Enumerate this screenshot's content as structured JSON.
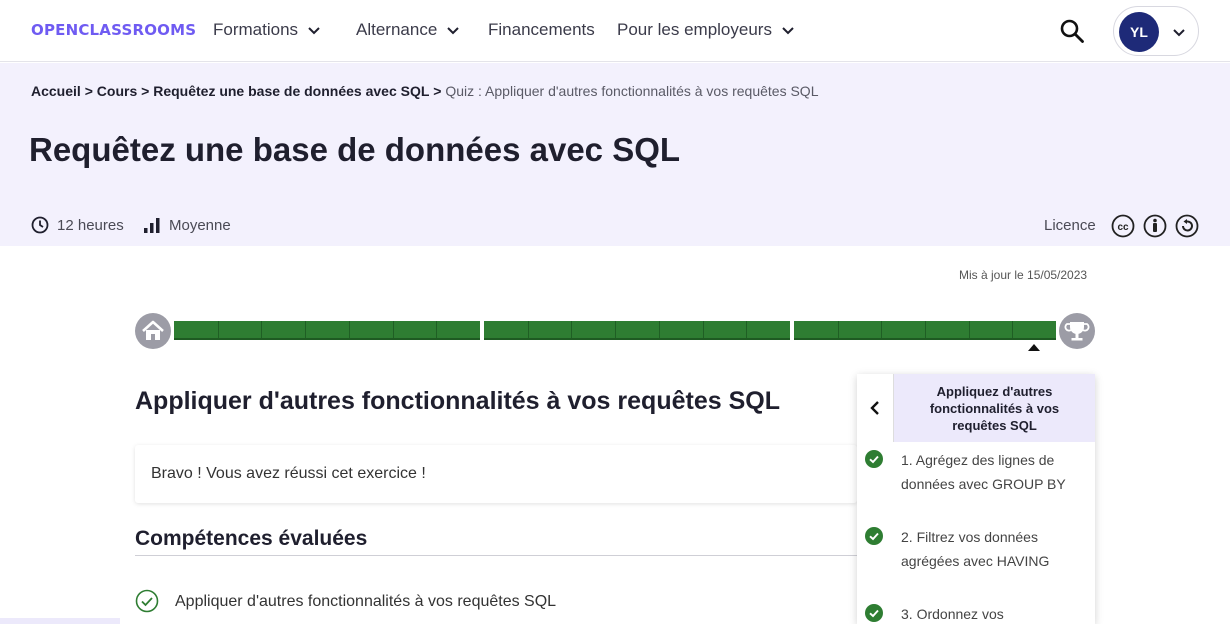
{
  "header": {
    "logo": "OPENCLASSROOMS",
    "nav": [
      {
        "label": "Formations",
        "has_dropdown": true
      },
      {
        "label": "Alternance",
        "has_dropdown": true
      },
      {
        "label": "Financements",
        "has_dropdown": false
      },
      {
        "label": "Pour les employeurs",
        "has_dropdown": true
      }
    ],
    "user_initials": "YL",
    "search_icon": "search-icon"
  },
  "breadcrumb": {
    "items": [
      "Accueil",
      "Cours",
      "Requêtez une base de données avec SQL"
    ],
    "separator": ">",
    "current": "Quiz : Appliquer d'autres fonctionnalités à vos requêtes SQL"
  },
  "course": {
    "title": "Requêtez une base de données avec SQL",
    "duration": "12 heures",
    "level": "Moyenne",
    "licence_label": "Licence",
    "licence_icons": [
      "cc-icon",
      "by-icon",
      "sa-icon"
    ],
    "updated": "Mis à jour le 15/05/2023"
  },
  "progress": {
    "parts": [
      7,
      7,
      6
    ],
    "completed": [
      7,
      7,
      6
    ],
    "color": "#2e7d32"
  },
  "quiz": {
    "title": "Appliquer d'autres fonctionnalités à vos requêtes SQL",
    "result": "Bravo ! Vous avez réussi cet exercice !",
    "skills_title": "Compétences évaluées",
    "skills": [
      "Appliquer d'autres fonctionnalités à vos requêtes SQL"
    ]
  },
  "panel": {
    "title": "Appliquez d'autres fonctionnalités à vos requêtes SQL",
    "items": [
      {
        "label": "1. Agrégez des lignes de données avec GROUP BY",
        "done": true
      },
      {
        "label": "2. Filtrez vos données agrégées avec HAVING",
        "done": true
      },
      {
        "label": "3. Ordonnez vos",
        "done": true
      }
    ]
  }
}
